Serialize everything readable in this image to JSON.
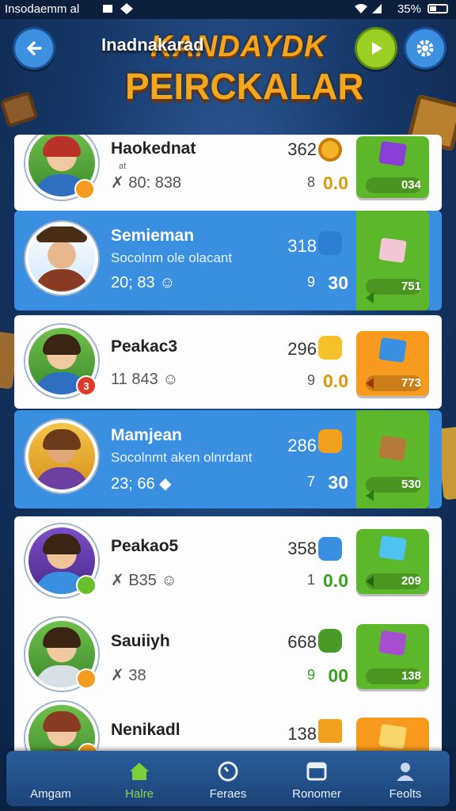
{
  "status_bar": {
    "carrier": "Insodaemm al",
    "battery": "35%"
  },
  "header": {
    "title": "Inadnakarad",
    "logo_line1": "KANDAYDK",
    "logo_line2": "PEIRCKALAR"
  },
  "players": [
    {
      "name": "Haokednat",
      "subtitle": "",
      "small_label": "at",
      "stat": "80: 838",
      "score": "362",
      "level": "8",
      "value": "0.0",
      "reward": "034",
      "style": "white"
    },
    {
      "name": "Semieman",
      "subtitle": "Socolnm ole olacant",
      "stat": "20; 83",
      "score": "318",
      "level": "9",
      "value": "30",
      "reward": "751",
      "style": "blue"
    },
    {
      "name": "Peakac3",
      "subtitle": "",
      "stat": "11 843",
      "score": "296",
      "level": "9",
      "value": "0.0",
      "reward": "773",
      "style": "white",
      "badge": "3"
    },
    {
      "name": "Mamjean",
      "subtitle": "Socolnmt aken olnrdant",
      "stat": "23; 66",
      "score": "286",
      "level": "7",
      "value": "30",
      "reward": "530",
      "style": "blue"
    },
    {
      "name": "Peakao5",
      "subtitle": "",
      "stat": "B35",
      "score": "358",
      "level": "1",
      "value": "0.0",
      "reward": "209",
      "style": "white"
    },
    {
      "name": "Sauiiyh",
      "subtitle": "",
      "stat": "38",
      "score": "668",
      "level": "9",
      "value": "00",
      "reward": "138",
      "style": "white"
    },
    {
      "name": "Nenikadl",
      "subtitle": "",
      "stat": "",
      "score": "138",
      "level": "",
      "value": "",
      "reward": "",
      "style": "white"
    }
  ],
  "nav": [
    {
      "label": "Amgam",
      "icon": "person-icon"
    },
    {
      "label": "Halre",
      "icon": "home-icon"
    },
    {
      "label": "Feraes",
      "icon": "clock-icon"
    },
    {
      "label": "Ronomer",
      "icon": "window-icon"
    },
    {
      "label": "Feolts",
      "icon": "group-icon"
    }
  ],
  "colors": {
    "accent_blue": "#3a8fe0",
    "reward_green": "#5cb82a",
    "reward_orange": "#f79a1e",
    "nav_active": "#8fd64a",
    "logo_gold": "#f2a81e"
  }
}
